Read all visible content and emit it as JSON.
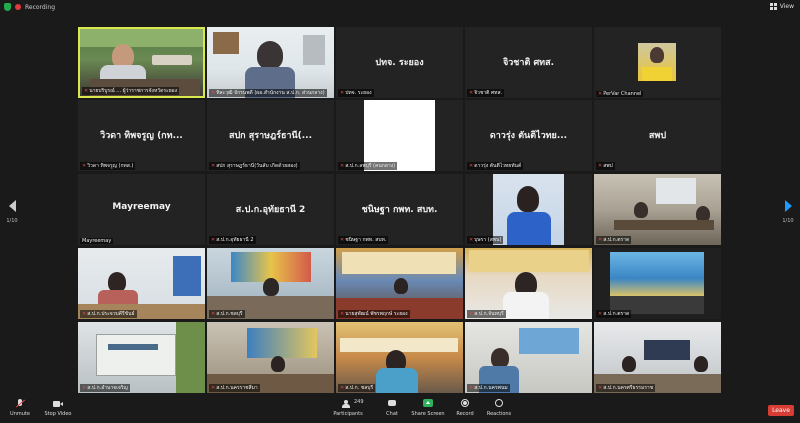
{
  "topbar": {
    "recording_label": "Recording",
    "view_label": "View"
  },
  "pager": {
    "left": "1/10",
    "right": "1/10"
  },
  "tiles": [
    {
      "big": "",
      "name": "นายบริบูรณ์ ... ผู้ว่าราชการจังหวัดระยอง"
    },
    {
      "big": "",
      "name": "ทิสะวุฒิ จักรนพดี (ผอ.สำนักงาน ส.ป.ก. ส่วนกลาง)"
    },
    {
      "big": "ปทจ. ระยอง",
      "name": "ปทจ. ระยอง"
    },
    {
      "big": "จิวชาติ ศทส.",
      "name": "จิวชาติ ศทส."
    },
    {
      "big": "",
      "name": "PerVar Channel"
    },
    {
      "big": "วิวดา ทิพจรูญ (กท...",
      "name": "วิวดา ทิพจรูญ (กทส.)"
    },
    {
      "big": "สปก สุราษฎร์ธานี(...",
      "name": "สปก สุราษฎร์ธานี(วันลับ เกิดด้วยสอง)"
    },
    {
      "big": "",
      "name": "ส.ป.ก.ลพบุรี (คนกลาง)"
    },
    {
      "big": "ดาวรุ่ง ตันติไวทย...",
      "name": "ดาวรุ่ง ตันติไวทยทันต์"
    },
    {
      "big": "สพป",
      "name": "สพป"
    },
    {
      "big": "Mayreemay",
      "name": "Mayreemay"
    },
    {
      "big": "ส.ป.ก.อุทัยธานี 2",
      "name": "ส.ป.ก.อุทัยธานี 2"
    },
    {
      "big": "ชนิษฐา กพท. สบท.",
      "name": "ชนิษฐา กพท. สบท."
    },
    {
      "big": "",
      "name": "บุษรา (สพน)"
    },
    {
      "big": "",
      "name": "ส.ป.ก.ตราด"
    },
    {
      "big": "",
      "name": "ส.ป.ก.ประจวบคีรีขันธ์"
    },
    {
      "big": "",
      "name": "ส.ป.ก.ชลบุรี"
    },
    {
      "big": "",
      "name": "นายสุพัฒน์ พัชรพฤกษ์ ระยอง"
    },
    {
      "big": "",
      "name": "ส.ป.ก.จันทบุรี"
    },
    {
      "big": "",
      "name": "ส.ป.ก.ตราด"
    },
    {
      "big": "",
      "name": "ส.ป.ก.อำนาจเจริญ"
    },
    {
      "big": "",
      "name": "ส.ป.ก.นครราชสีมา"
    },
    {
      "big": "",
      "name": "ส.ป.ก. ชลบุรี"
    },
    {
      "big": "",
      "name": "ส.ป.ก.นครพนม"
    },
    {
      "big": "",
      "name": "ส.ป.ก.นครศรีธรรมราช"
    }
  ],
  "bottombar": {
    "unmute": "Unmute",
    "stop_video": "Stop Video",
    "participants": "Participants",
    "participants_count": "249",
    "chat": "Chat",
    "share_screen": "Share Screen",
    "record": "Record",
    "reactions": "Reactions",
    "leave": "Leave"
  }
}
